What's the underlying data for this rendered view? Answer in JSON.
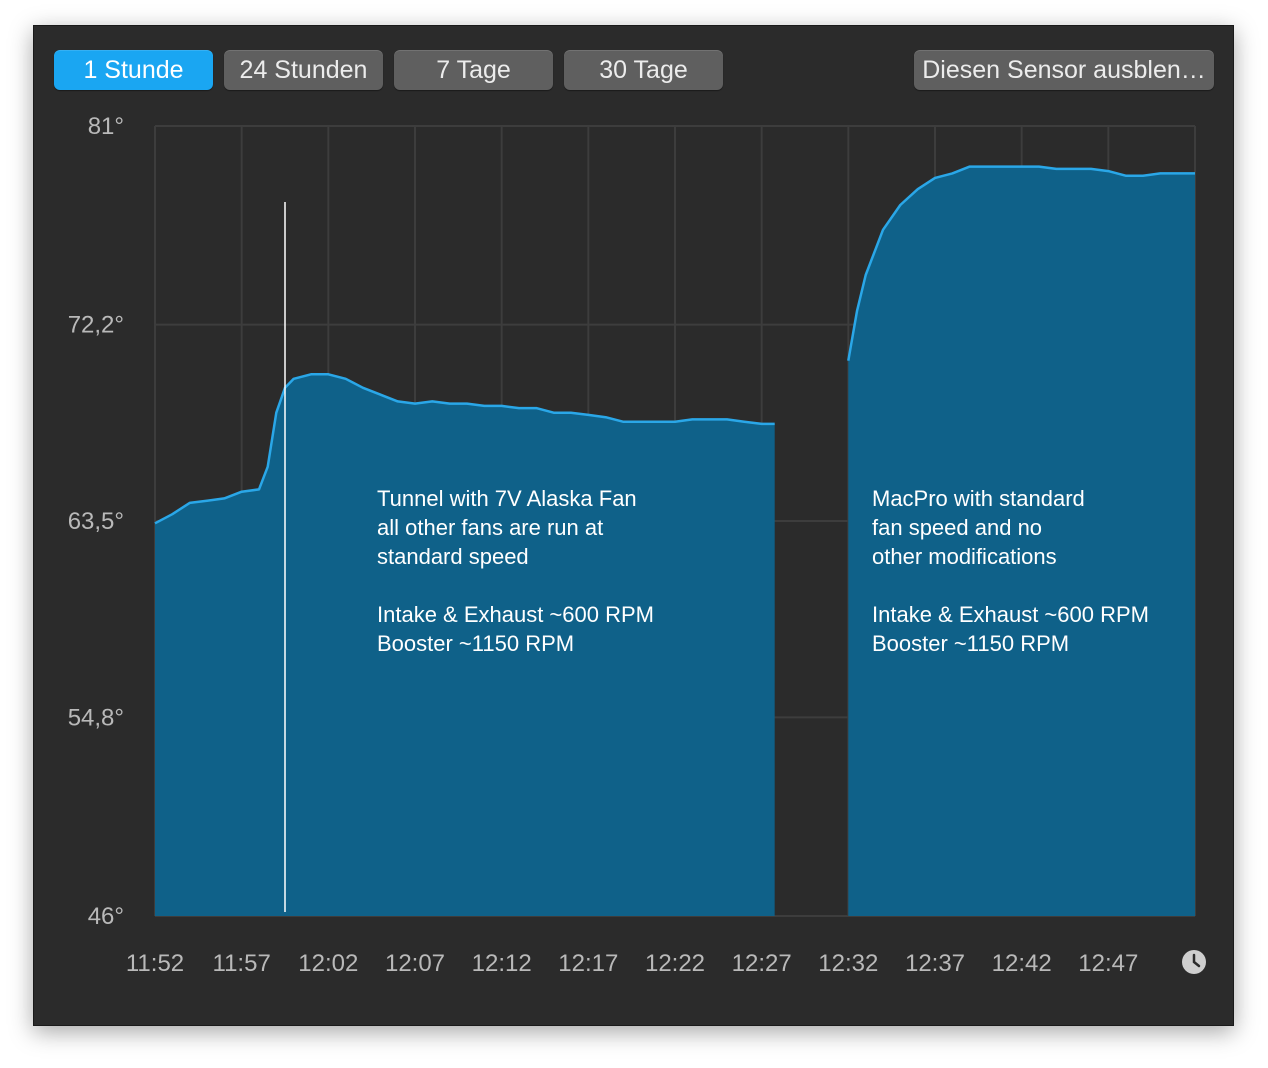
{
  "toolbar": {
    "buttons": [
      {
        "label": "1 Stunde",
        "active": true
      },
      {
        "label": "24 Stunden",
        "active": false
      },
      {
        "label": "7 Tage",
        "active": false
      },
      {
        "label": "30 Tage",
        "active": false
      }
    ],
    "hide_label": "Diesen Sensor ausblen…"
  },
  "colors": {
    "background": "#2b2b2b",
    "active_button": "#1aa6f2",
    "button": "#5f5f5f",
    "area_fill": "#0f6189",
    "line": "#2aa7e8",
    "grid": "#3d3d3d"
  },
  "clock_icon": "clock-icon",
  "chart_data": {
    "type": "area",
    "unit": "°",
    "ylim": [
      46,
      81
    ],
    "yticks": [
      "81°",
      "72,2°",
      "63,5°",
      "54,8°",
      "46°"
    ],
    "ytick_values": [
      81,
      72.2,
      63.5,
      54.8,
      46
    ],
    "xticks": [
      "11:52",
      "11:57",
      "12:02",
      "12:07",
      "12:12",
      "12:17",
      "12:22",
      "12:27",
      "12:32",
      "12:37",
      "12:42",
      "12:47"
    ],
    "xlim": [
      "11:52",
      "12:52"
    ],
    "grid": true,
    "marker_time": "11:59:30",
    "series": [
      {
        "points": [
          [
            "11:52",
            63.4
          ],
          [
            "11:53",
            63.8
          ],
          [
            "11:54",
            64.3
          ],
          [
            "11:55",
            64.4
          ],
          [
            "11:56",
            64.5
          ],
          [
            "11:57",
            64.8
          ],
          [
            "11:58",
            64.9
          ],
          [
            "11:58:30",
            65.9
          ],
          [
            "11:59",
            68.3
          ],
          [
            "11:59:30",
            69.4
          ],
          [
            "12:00",
            69.8
          ],
          [
            "12:01",
            70.0
          ],
          [
            "12:02",
            70.0
          ],
          [
            "12:03",
            69.8
          ],
          [
            "12:04",
            69.4
          ],
          [
            "12:05",
            69.1
          ],
          [
            "12:06",
            68.8
          ],
          [
            "12:07",
            68.7
          ],
          [
            "12:08",
            68.8
          ],
          [
            "12:09",
            68.7
          ],
          [
            "12:10",
            68.7
          ],
          [
            "12:11",
            68.6
          ],
          [
            "12:12",
            68.6
          ],
          [
            "12:13",
            68.5
          ],
          [
            "12:14",
            68.5
          ],
          [
            "12:15",
            68.3
          ],
          [
            "12:16",
            68.3
          ],
          [
            "12:17",
            68.2
          ],
          [
            "12:18",
            68.1
          ],
          [
            "12:19",
            67.9
          ],
          [
            "12:20",
            67.9
          ],
          [
            "12:21",
            67.9
          ],
          [
            "12:22",
            67.9
          ],
          [
            "12:23",
            68.0
          ],
          [
            "12:24",
            68.0
          ],
          [
            "12:25",
            68.0
          ],
          [
            "12:26",
            67.9
          ],
          [
            "12:27",
            67.8
          ],
          [
            "12:27:45",
            67.8
          ]
        ]
      },
      {
        "points": [
          [
            "12:32",
            70.6
          ],
          [
            "12:32:30",
            72.8
          ],
          [
            "12:33",
            74.4
          ],
          [
            "12:34",
            76.4
          ],
          [
            "12:35",
            77.5
          ],
          [
            "12:36",
            78.2
          ],
          [
            "12:37",
            78.7
          ],
          [
            "12:38",
            78.9
          ],
          [
            "12:39",
            79.2
          ],
          [
            "12:40",
            79.2
          ],
          [
            "12:41",
            79.2
          ],
          [
            "12:42",
            79.2
          ],
          [
            "12:43",
            79.2
          ],
          [
            "12:44",
            79.1
          ],
          [
            "12:45",
            79.1
          ],
          [
            "12:46",
            79.1
          ],
          [
            "12:47",
            79.0
          ],
          [
            "12:48",
            78.8
          ],
          [
            "12:49",
            78.8
          ],
          [
            "12:50",
            78.9
          ],
          [
            "12:51",
            78.9
          ],
          [
            "12:52",
            78.9
          ]
        ]
      }
    ],
    "annotations": [
      {
        "at": "12:00",
        "lines": [
          "Tunnel with 7V Alaska Fan",
          "all other fans are run at",
          "standard speed",
          "",
          "Intake & Exhaust ~600 RPM",
          "Booster ~1150 RPM"
        ]
      },
      {
        "at": "12:33",
        "lines": [
          "MacPro with standard",
          "fan speed and no",
          "other modifications",
          "",
          "Intake & Exhaust ~600 RPM",
          "Booster ~1150 RPM"
        ]
      }
    ]
  }
}
